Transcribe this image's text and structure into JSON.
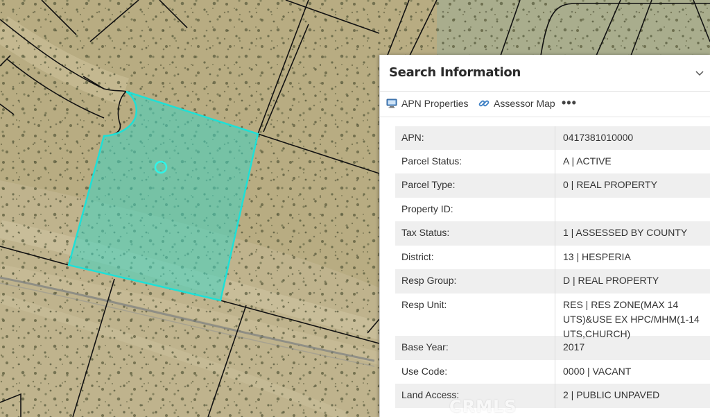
{
  "panel": {
    "title": "Search Information",
    "toolbar": {
      "apn_properties": "APN Properties",
      "assessor_map": "Assessor Map",
      "more": "•••"
    }
  },
  "properties": [
    {
      "label": "APN:",
      "value": "0417381010000"
    },
    {
      "label": "Parcel Status:",
      "value": "A | ACTIVE"
    },
    {
      "label": "Parcel Type:",
      "value": "0 | REAL PROPERTY"
    },
    {
      "label": "Property ID:",
      "value": ""
    },
    {
      "label": "Tax Status:",
      "value": "1 | ASSESSED BY COUNTY"
    },
    {
      "label": "District:",
      "value": "13 | HESPERIA"
    },
    {
      "label": "Resp Group:",
      "value": "D | REAL PROPERTY"
    },
    {
      "label": "Resp Unit:",
      "value": "RES | RES ZONE(MAX 14 UTS)&USE EX HPC/MHM(1-14 UTS,CHURCH)"
    },
    {
      "label": "Base Year:",
      "value": "2017"
    },
    {
      "label": "Use Code:",
      "value": "0000 | VACANT"
    },
    {
      "label": "Land Access:",
      "value": "2 | PUBLIC UNPAVED"
    }
  ],
  "watermark": "CRMLS",
  "colors": {
    "parcel_fill": "#3fd6c3",
    "parcel_stroke": "#1fe0d6",
    "terrain": "#b9ad84",
    "parcel_lines": "#111111"
  }
}
